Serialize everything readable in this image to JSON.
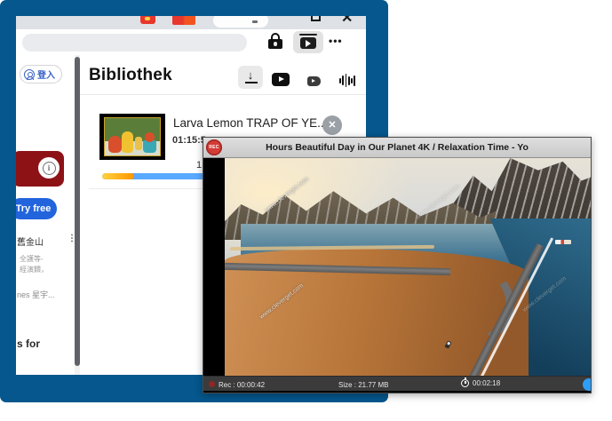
{
  "frame": {
    "accent_blue": "#05578d"
  },
  "browser": {
    "window_controls": {
      "maximize_icon": "maximize-square",
      "close_glyph": "✕"
    },
    "toolbar": {
      "url_value": "",
      "lock_icon": "padlock",
      "extension_icon": "video-library",
      "more_glyph": "•••"
    },
    "sidebar": {
      "signin_label": "登入",
      "info_glyph": "i",
      "try_free_label": "Try free",
      "rows": [
        {
          "text": "舊金山",
          "menu_glyph": "⋮"
        },
        {
          "text": "全護等-"
        },
        {
          "text": "經演饋，"
        },
        {
          "text": "nes 星宇..."
        },
        {
          "text": "s for"
        }
      ]
    },
    "library": {
      "title": "Bibliothek",
      "download_glyph": "↓",
      "youtube_icon": "youtube-play",
      "mini_player_icon": "small-play",
      "audio_icon": "waveform",
      "item": {
        "title": "Larva Lemon  TRAP OF YE...",
        "duration_fragment": "01:15:5",
        "meta_fragment": "1",
        "close_glyph": "✕",
        "progress": {
          "downloaded_fraction": 0.15,
          "downloaded_colors": [
            "#ffd23f",
            "#ff9500"
          ],
          "remaining_color": "#58a9ff"
        }
      }
    }
  },
  "recorder": {
    "title": "Hours Beautiful Day in Our Planet 4K / Relaxation Time - Yo",
    "rec_badge_label": "REC",
    "watermark": "www.cleverget.com",
    "status": {
      "rec_label": "Rec : 00:00:42",
      "size_label": "Size : 21.77 MB",
      "time_label": "00:02:18"
    }
  }
}
